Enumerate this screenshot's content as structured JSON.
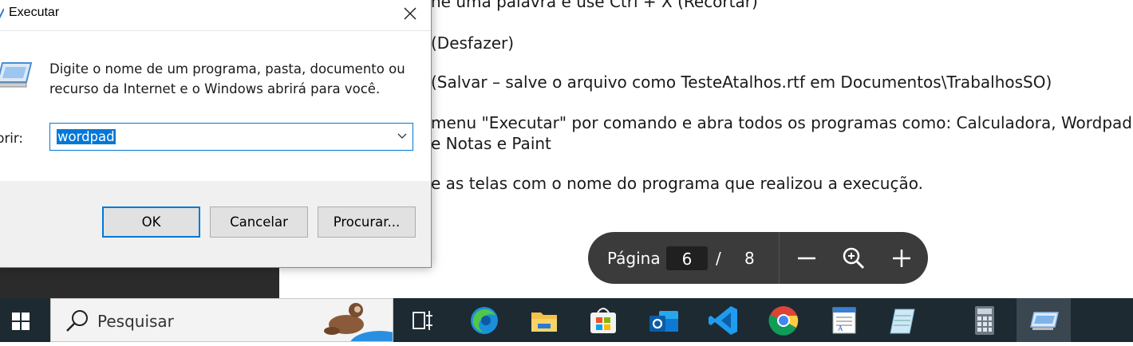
{
  "document": {
    "lines": [
      "ne uma palavra e use Ctrl + X (Recortar)",
      "(Desfazer)",
      "(Salvar – salve o arquivo como TesteAtalhos.rtf em Documentos\\TrabalhosSO)",
      "menu \"Executar\" por comando e abra todos os programas como: Calculadora, Wordpad",
      "e Notas e Paint",
      "e as telas com o nome do programa que realizou a execução."
    ]
  },
  "pdf_toolbar": {
    "page_label": "Página",
    "current_page": "6",
    "separator": "/",
    "total_pages": "8"
  },
  "run_dialog": {
    "title": "Executar",
    "description": "Digite o nome de um programa, pasta, documento ou recurso da Internet e o Windows abrirá para você.",
    "open_label": "brir:",
    "input_value": "wordpad",
    "buttons": {
      "ok": "OK",
      "cancel": "Cancelar",
      "browse": "Procurar..."
    },
    "accent": "#0078d7"
  },
  "taskbar": {
    "search_placeholder": "Pesquisar",
    "apps": [
      "task-view",
      "edge",
      "file-explorer",
      "microsoft-store",
      "outlook",
      "vscode",
      "chrome",
      "wordpad",
      "notepad",
      "calculator",
      "run"
    ]
  }
}
